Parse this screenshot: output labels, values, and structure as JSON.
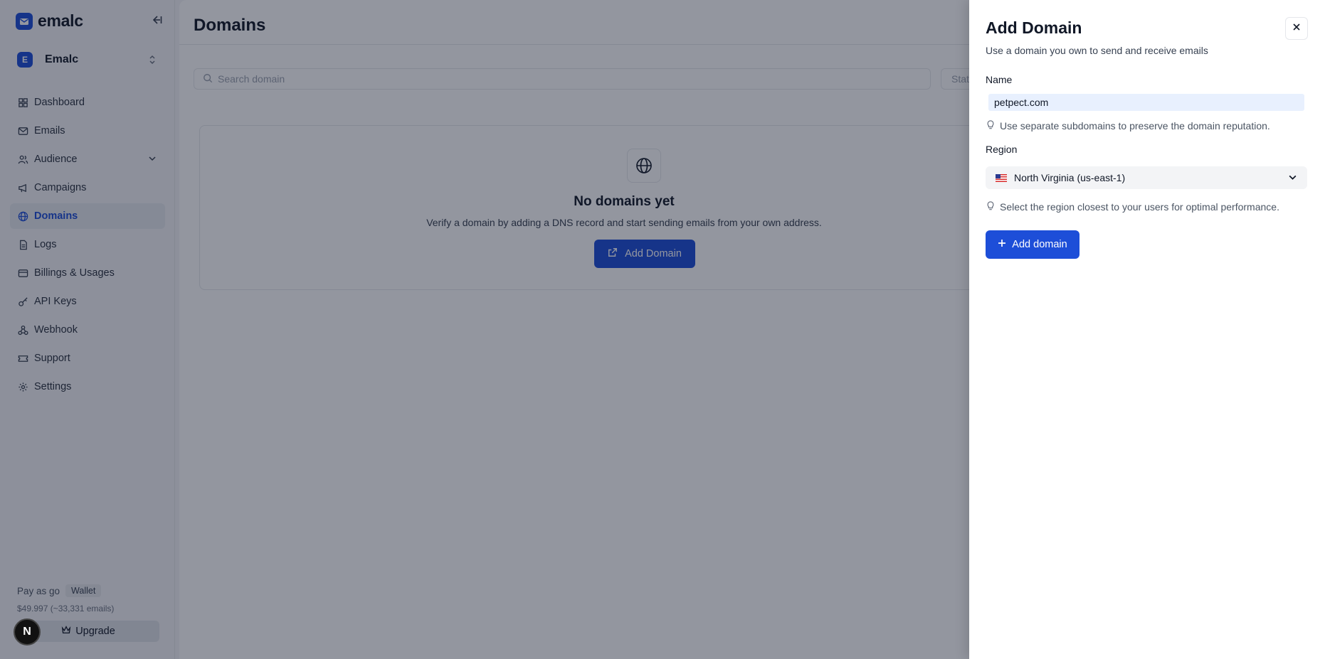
{
  "brand": {
    "name": "emalc"
  },
  "workspace": {
    "initial": "E",
    "name": "Emalc"
  },
  "sidebar": {
    "items": [
      {
        "label": "Dashboard",
        "icon": "grid-icon"
      },
      {
        "label": "Emails",
        "icon": "mail-icon"
      },
      {
        "label": "Audience",
        "icon": "users-icon",
        "expandable": true
      },
      {
        "label": "Campaigns",
        "icon": "megaphone-icon"
      },
      {
        "label": "Domains",
        "icon": "globe-icon",
        "active": true
      },
      {
        "label": "Logs",
        "icon": "file-icon"
      },
      {
        "label": "Billings & Usages",
        "icon": "card-icon"
      },
      {
        "label": "API Keys",
        "icon": "key-icon"
      },
      {
        "label": "Webhook",
        "icon": "webhook-icon"
      },
      {
        "label": "Support",
        "icon": "ticket-icon"
      },
      {
        "label": "Settings",
        "icon": "gear-icon"
      }
    ],
    "plan_label": "Pay as go",
    "wallet_badge": "Wallet",
    "balance": "$49.997 (~33,331 emails)",
    "upgrade_label": "Upgrade",
    "n_badge": "N"
  },
  "main": {
    "title": "Domains",
    "search_placeholder": "Search domain",
    "status_placeholder": "Status",
    "empty": {
      "title": "No domains yet",
      "description": "Verify a domain by adding a DNS record and start sending emails from your own address.",
      "button": "Add Domain"
    }
  },
  "panel": {
    "title": "Add Domain",
    "subtitle": "Use a domain you own to send and receive emails",
    "name_label": "Name",
    "name_value": "petpect.com",
    "name_hint": "Use separate subdomains to preserve the domain reputation.",
    "region_label": "Region",
    "region_value": "North Virginia (us-east-1)",
    "region_hint": "Select the region closest to your users for optimal performance.",
    "submit": "Add domain"
  },
  "colors": {
    "accent": "#1d4ed8",
    "overlay": "rgba(15,23,42,0.45)"
  }
}
